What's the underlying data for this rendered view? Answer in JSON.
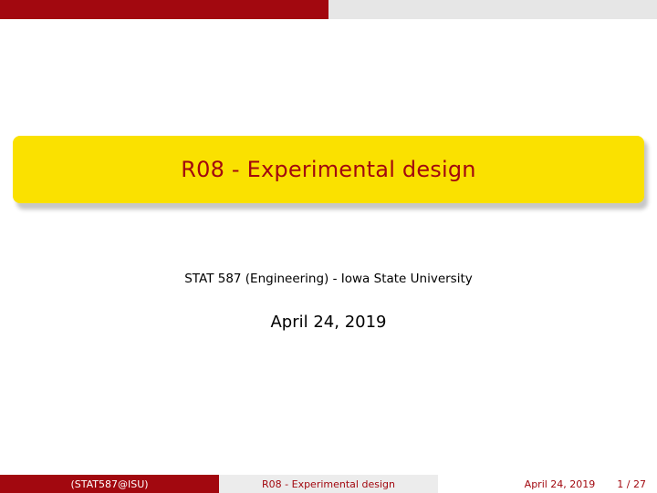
{
  "slide": {
    "title": "R08 - Experimental design",
    "author": "STAT 587 (Engineering) - Iowa State University",
    "date": "April 24, 2019"
  },
  "footer": {
    "left": "(STAT587@ISU)",
    "center": "R08 - Experimental design",
    "date": "April 24, 2019",
    "page": "1 / 27"
  },
  "colors": {
    "accent_red": "#a2080f",
    "title_yellow": "#fae100",
    "light_grey": "#e6e6e6"
  }
}
